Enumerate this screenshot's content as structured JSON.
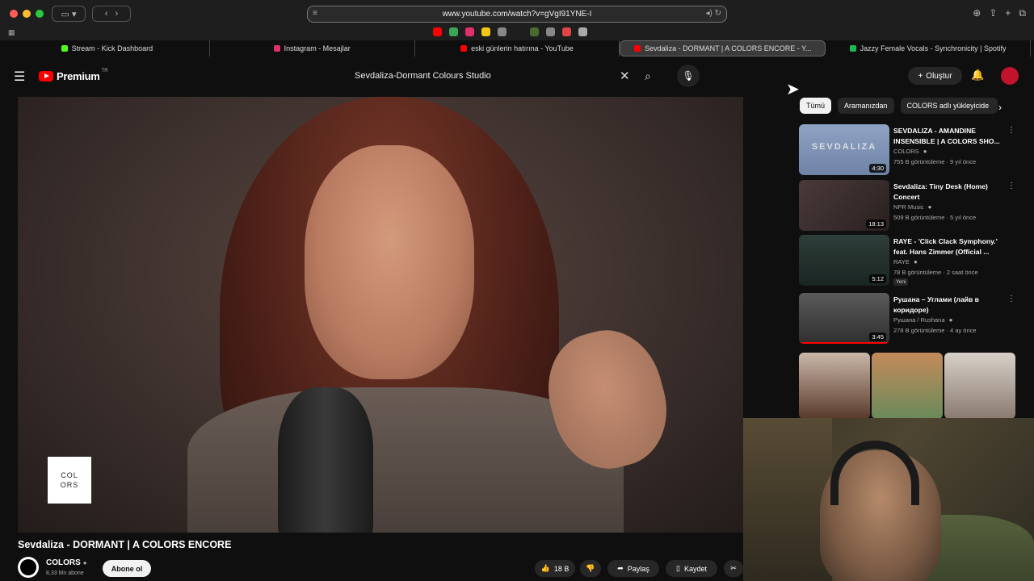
{
  "browser": {
    "url": "www.youtube.com/watch?v=gVgI91YNE-I",
    "tabs": [
      {
        "label": "Stream - Kick Dashboard",
        "color": "#53fc18"
      },
      {
        "label": "Instagram - Mesajlar",
        "color": "#e1306c"
      },
      {
        "label": "eski günlerin hatırına - YouTube",
        "color": "#ff0000"
      },
      {
        "label": "Sevdaliza - DORMANT | A COLORS ENCORE - Y...",
        "color": "#ff0000"
      },
      {
        "label": "Jazzy Female Vocals - Synchronicity | Spotify",
        "color": "#1db954"
      }
    ]
  },
  "header": {
    "logo_text": "Premium",
    "logo_region": "TR",
    "search_query": "Sevdaliza-Dormant Colours Studio",
    "create_label": "Oluştur"
  },
  "video": {
    "title": "Sevdaliza - DORMANT | A COLORS ENCORE",
    "badge": "COL ORS",
    "channel": "COLORS",
    "subscribers": "8,33 Mn abone",
    "subscribe_label": "Abone ol",
    "likes": "18 B",
    "share_label": "Paylaş",
    "save_label": "Kaydet"
  },
  "sidebar": {
    "chips": [
      "Tümü",
      "Aramanızdan",
      "COLORS adlı yükleyicide"
    ],
    "recommendations": [
      {
        "title": "SEVDALIZA - AMANDINE INSENSIBLE | A COLORS SHO...",
        "channel": "COLORS",
        "meta": "755 B görüntüleme · 9 yıl önce",
        "duration": "4:30",
        "thumb_text": "SEVDALIZA",
        "verified": true,
        "new": ""
      },
      {
        "title": "Sevdaliza: Tiny Desk (Home) Concert",
        "channel": "NPR Music",
        "meta": "509 B görüntüleme · 5 yıl önce",
        "duration": "18:13",
        "thumb_text": "",
        "verified": true,
        "new": ""
      },
      {
        "title": "RAYE - 'Click Clack Symphony.' feat. Hans Zimmer (Official ...",
        "channel": "RAYE",
        "meta": "78 B görüntüleme · 2 saat önce",
        "duration": "5:12",
        "thumb_text": "",
        "verified": true,
        "new": "Yeni"
      },
      {
        "title": "Рушана – Углами (лайв в коридоре)",
        "channel": "Рушана / Rushana",
        "meta": "278 B görüntüleme · 4 ay önce",
        "duration": "3:45",
        "thumb_text": "",
        "verified": true,
        "new": ""
      }
    ]
  },
  "colors": {
    "accent": "#ff0000",
    "bg": "#0f0f0f"
  }
}
